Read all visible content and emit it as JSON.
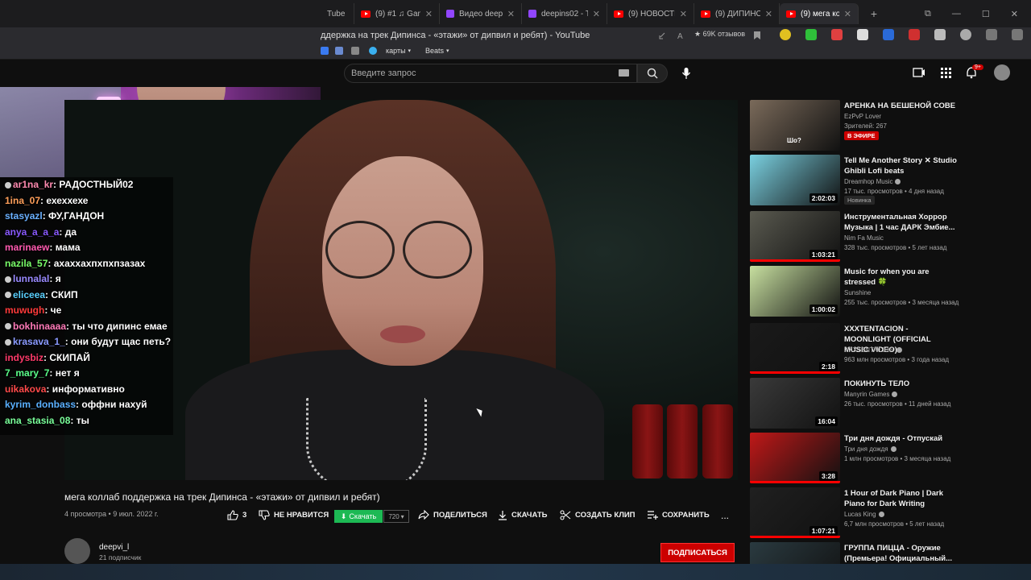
{
  "browser": {
    "tabs": [
      {
        "label": "Tube",
        "icon": "youtube-icon"
      },
      {
        "label": "(9) #1 ♫ Gam",
        "icon": "youtube-icon"
      },
      {
        "label": "Видео deepin",
        "icon": "twitch-icon"
      },
      {
        "label": "deepins02 - Tw",
        "icon": "twitch-icon"
      },
      {
        "label": "(9) НОВОСТИ ДЛЯ",
        "icon": "youtube-icon"
      },
      {
        "label": "(9) ДИПИНС ЖЕ",
        "icon": "youtube-icon"
      },
      {
        "label": "(9) мега коллаб",
        "icon": "youtube-icon",
        "active": true
      }
    ],
    "page_title": "ддержка на трек Дипинса - «этажи» от дипвил и ребят) - YouTube",
    "reviews": "69K отзывов",
    "bookmarks": [
      {
        "label": "карты"
      },
      {
        "label": "Beats"
      }
    ]
  },
  "header": {
    "search_placeholder": "Введите запрос",
    "notification_count": "9+"
  },
  "chat": [
    {
      "user": "ar1na_kr",
      "text": "РАДОСТНЫЙ02",
      "color": "#ff8ab0",
      "badge": true
    },
    {
      "user": "1ina_07",
      "text": "ехеххехе",
      "color": "#ff9f5a"
    },
    {
      "user": "stasyazl",
      "text": "ФУ,ГАНДОН",
      "color": "#6ab0ff"
    },
    {
      "user": "anya_a_a_a",
      "text": "да",
      "color": "#8a5aff"
    },
    {
      "user": "marinaew",
      "text": "мама",
      "color": "#ff5ab0"
    },
    {
      "user": "nazila_57",
      "text": "ахаххахпхпхпзазах",
      "color": "#7aff6a"
    },
    {
      "user": "lunnalal",
      "text": "я",
      "color": "#9a8aff",
      "badge": true
    },
    {
      "user": "eliceea",
      "text": "СКИП",
      "color": "#5ad0ff",
      "badge": true
    },
    {
      "user": "muwugh",
      "text": "че",
      "color": "#ff3a3a"
    },
    {
      "user": "bokhinaaaa",
      "text": "ты что дипинс емае",
      "color": "#ff7ab8",
      "badge": true
    },
    {
      "user": "krasava_1_",
      "text": "они будут щас петь?",
      "color": "#8a9aff",
      "badge": true
    },
    {
      "user": "indysbiz",
      "text": "СКИПАЙ",
      "color": "#ff3a6a"
    },
    {
      "user": "7_mary_7",
      "text": "нет я",
      "color": "#5aff8a"
    },
    {
      "user": "uikakova",
      "text": "информативно",
      "color": "#ff4a4a"
    },
    {
      "user": "kyrim_donbass",
      "text": "оффни нахуй",
      "color": "#5ab0ff"
    },
    {
      "user": "ana_stasia_08",
      "text": "ты",
      "color": "#7aff9a"
    }
  ],
  "video": {
    "title": "мега коллаб поддержка на трек Дипинса - «этажи» от дипвил и ребят)",
    "views": "4 просмотра",
    "date": "9 июл. 2022 г.",
    "likes": "3",
    "dislike_label": "НЕ НРАВИТСЯ",
    "download_ext_label": "Скачать",
    "quality": "720",
    "share_label": "ПОДЕЛИТЬСЯ",
    "download_label": "СКАЧАТЬ",
    "clip_label": "СОЗДАТЬ КЛИП",
    "save_label": "СОХРАНИТЬ",
    "more_label": "..."
  },
  "channel": {
    "name": "deepvi_l",
    "subs": "21 подписчик",
    "subscribe_label": "ПОДПИСАТЬСЯ"
  },
  "recommendations": [
    {
      "title": "АРЕНКА НА БЕШЕНОЙ СОВЕ",
      "channel": "EzPvP Lover",
      "meta": "Зрителей: 267",
      "live": "В ЭФИРЕ",
      "thumb_color": "#7a6a5a",
      "overlay_text": "Шо?"
    },
    {
      "title": "Tell Me Another Story ✕ Studio Ghibli Lofi beats",
      "channel": "Dreamhop Music",
      "meta": "17 тыс. просмотров • 4 дня назад",
      "duration": "2:02:03",
      "new": "Новинка",
      "thumb_color": "#7ad0e0",
      "verified": true
    },
    {
      "title": "Инструментальная Хоррор Музыка | 1 час ДАРК Эмбие...",
      "channel": "Nim Fa Music",
      "meta": "328 тыс. просмотров • 5 лет назад",
      "duration": "1:03:21",
      "thumb_color": "#5a5a50",
      "progress": 1.0
    },
    {
      "title": "Music for when you are stressed 🍀",
      "channel": "Sunshine",
      "meta": "255 тыс. просмотров • 3 месяца назад",
      "duration": "1:00:02",
      "thumb_color": "#c8e0a0"
    },
    {
      "title": "XXXTENTACION - MOONLIGHT (OFFICIAL MUSIC VIDEO)",
      "channel": "XXXTENTACION",
      "meta": "963 млн просмотров • 3 года назад",
      "duration": "2:18",
      "thumb_color": "#1a1a1a",
      "progress": 1.0,
      "verified": true
    },
    {
      "title": "ПОКИНУТЬ ТЕЛО",
      "channel": "Manyrin Games",
      "meta": "26 тыс. просмотров • 11 дней назад",
      "duration": "16:04",
      "thumb_color": "#3a3a3a",
      "verified": true
    },
    {
      "title": "Три дня дождя - Отпускай",
      "channel": "Три дня дождя",
      "meta": "1 млн просмотров • 3 месяца назад",
      "duration": "3:28",
      "thumb_color": "#c01818",
      "progress": 1.0,
      "verified": true
    },
    {
      "title": "1 Hour of Dark Piano | Dark Piano for Dark Writing",
      "channel": "Lucas King",
      "meta": "6,7 млн просмотров • 5 лет назад",
      "duration": "1:07:21",
      "thumb_color": "#202020",
      "progress": 1.0,
      "verified": true
    },
    {
      "title": "ГРУППА ПИЦЦА - Оружие (Премьера! Официальный...",
      "channel": "",
      "meta": "",
      "thumb_color": "#2a3a40"
    }
  ]
}
